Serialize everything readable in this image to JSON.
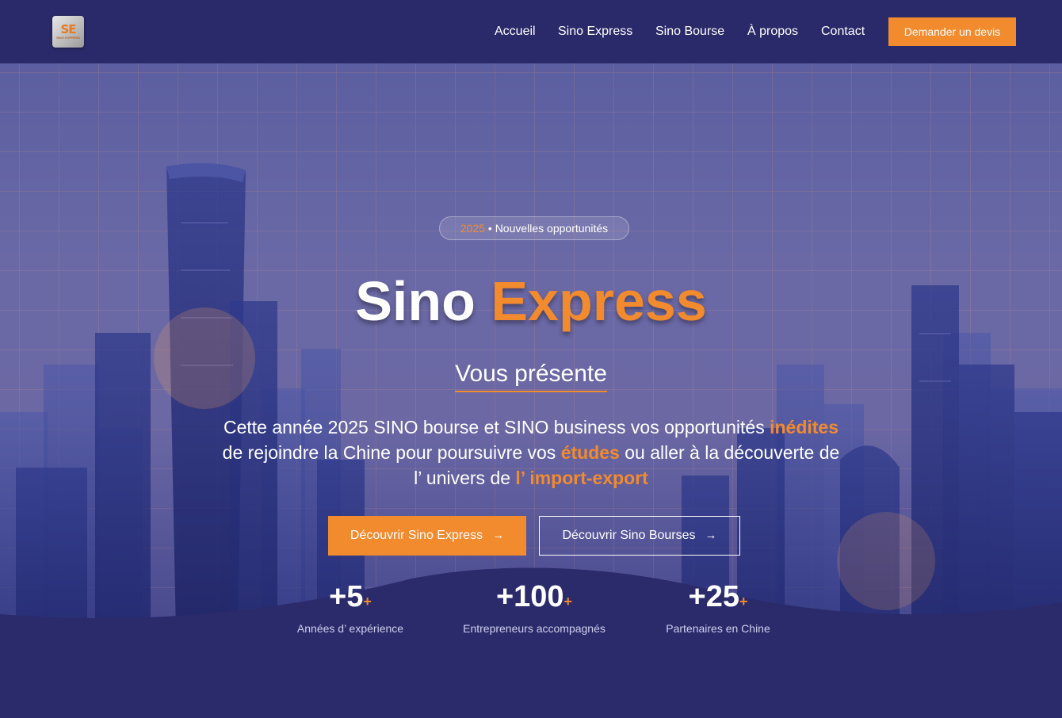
{
  "brand": {
    "logo_mark": "SE",
    "logo_sub": "SINO EXPRESS"
  },
  "nav": {
    "items": [
      {
        "label": "Accueil"
      },
      {
        "label": "Sino Express"
      },
      {
        "label": "Sino Bourse"
      },
      {
        "label": "À propos"
      },
      {
        "label": "Contact"
      }
    ],
    "cta_label": "Demander un devis"
  },
  "hero": {
    "badge_year": "2025",
    "badge_text": " • Nouvelles opportunités",
    "title_white": "Sino ",
    "title_accent": "Express",
    "subtitle": "Vous présente",
    "desc": {
      "part1": "Cette année 2025 SINO bourse et SINO business vos opportunités ",
      "hl1": "inédites",
      "part2": " de rejoindre la Chine pour poursuivre vos ",
      "hl2": "études",
      "part3": " ou aller à la découverte de l’ univers de ",
      "hl3": "l’ import-export"
    },
    "btn_primary": "Découvrir Sino Express",
    "btn_outline": "Découvrir Sino Bourses",
    "arrow_icon": "→"
  },
  "stats": [
    {
      "value": "+5",
      "plus": "+",
      "label": "Années d’ expérience"
    },
    {
      "value": "+100",
      "plus": "+",
      "label": "Entrepreneurs accompagnés"
    },
    {
      "value": "+25",
      "plus": "+",
      "label": "Partenaires en Chine"
    }
  ],
  "colors": {
    "accent": "#f28a2e",
    "navy": "#2a2969"
  }
}
